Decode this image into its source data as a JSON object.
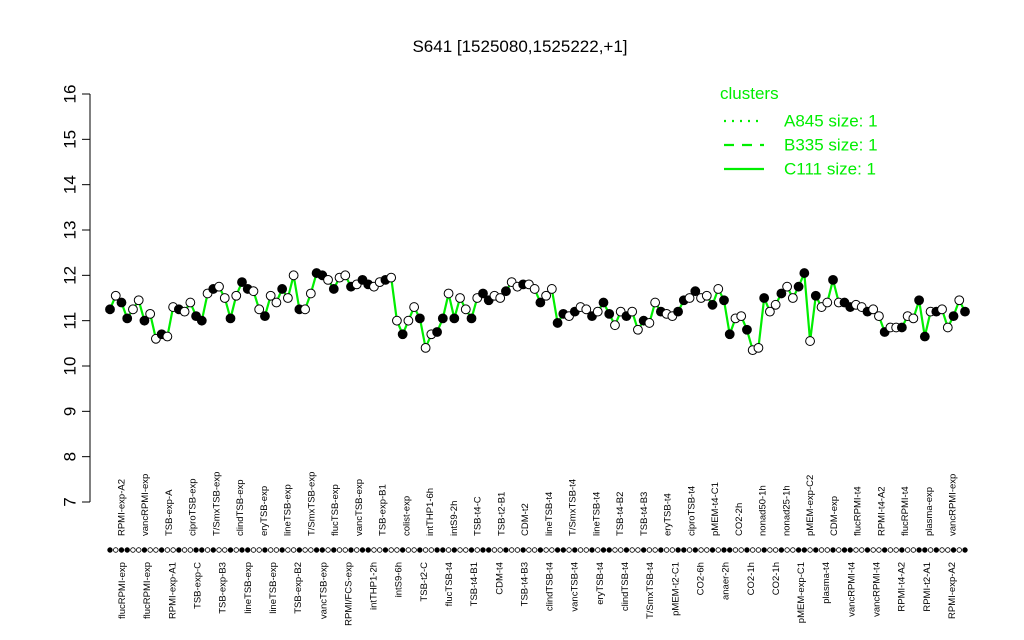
{
  "chart_data": {
    "type": "line",
    "title": "S641 [1525080,1525222,+1]",
    "xlabel": "",
    "ylabel": "",
    "ylim": [
      7,
      16
    ],
    "yticks": [
      7,
      8,
      9,
      10,
      11,
      12,
      13,
      14,
      15,
      16
    ],
    "grid": false,
    "line_color": "#00ee00",
    "legend": {
      "title": "clusters",
      "placement": "top-right",
      "color": "#00ee00",
      "entries": [
        {
          "label": "A845 size: 1",
          "style": "dotted"
        },
        {
          "label": "B335 size: 1",
          "style": "dashed"
        },
        {
          "label": "C111 size: 1",
          "style": "solid"
        }
      ]
    },
    "top_labels": [
      "RPMI-exp-A2",
      "vancRPMI-exp",
      "TSB-exp-A",
      "ciproTSB-exp",
      "T/SmxTSB-exp",
      "clindTSB-exp",
      "eryTSB-exp",
      "lineTSB-exp",
      "T/SmxTSB-exp",
      "flucTSB-exp",
      "vancTSB-exp",
      "TSB-exp-B1",
      "colist-exp",
      "intTHP1-6h",
      "intS9-2h",
      "TSB-t4-C",
      "TSB-t2-B1",
      "CDM-t2",
      "lineTSB-t4",
      "T/SmxTSB-t4",
      "lineTSB-t4",
      "TSB-t4-B2",
      "TSB-t4-B3",
      "eryTSB-t4",
      "ciproTSB-t4",
      "pMEM-t4-C1",
      "CO2-2h",
      "nonad50-1h",
      "nonad25-1h",
      "pMEM-exp-C2",
      "CDM-exp",
      "flucRPMI-t4",
      "RPMI-t4-A2",
      "flucRPMI-t4",
      "plasma-exp",
      "vancRPMI-exp"
    ],
    "bottom_labels": [
      "flucRPMI-exp",
      "flucRPMI-exp",
      "RPMI-exp-A1",
      "TSB-exp-C",
      "TSB-exp-B3",
      "lineTSB-exp",
      "lineTSB-exp",
      "TSB-exp-B2",
      "vancTSB-exp",
      "RPMI/FCS-exp",
      "intTHP1-2h",
      "intS9-6h",
      "TSB-t2-C",
      "flucTSB-t4",
      "TSB-t4-B1",
      "CDM-t4",
      "TSB-t4-B3",
      "clindTSB-t4",
      "vancTSB-t4",
      "eryTSB-t4",
      "clindTSB-t4",
      "T/SmxTSB-t4",
      "pMEM-t2-C1",
      "CO2-6h",
      "anaer-2h",
      "CO2-1h",
      "CO2-1h",
      "pMEM-exp-C1",
      "plasma-t4",
      "vancRPMI-t4",
      "vancRPMI-t4",
      "RPMI-t4-A2",
      "RPMI-t2-A1",
      "RPMI-exp-A2"
    ],
    "series": [
      {
        "values": [
          11.25,
          11.55,
          11.4,
          11.05,
          11.25,
          11.45,
          11.0,
          11.15,
          10.6,
          10.7,
          10.65,
          11.3,
          11.25,
          11.2,
          11.4,
          11.1,
          11.0,
          11.6,
          11.7,
          11.75,
          11.5,
          11.05,
          11.55,
          11.85,
          11.7,
          11.65,
          11.25,
          11.1,
          11.55,
          11.4,
          11.7,
          11.5,
          12.0,
          11.25,
          11.25,
          11.6,
          12.05,
          12.0,
          11.9,
          11.7,
          11.95,
          12.0,
          11.75,
          11.8,
          11.9,
          11.8,
          11.75,
          11.85,
          11.9,
          11.95,
          11.0,
          10.7,
          11.0,
          11.3,
          11.05,
          10.4,
          10.7,
          10.75,
          11.05,
          11.6,
          11.05,
          11.5,
          11.25,
          11.05,
          11.5,
          11.6,
          11.45,
          11.55,
          11.5,
          11.65,
          11.85,
          11.75,
          11.8,
          11.8,
          11.7,
          11.4,
          11.55,
          11.7,
          10.95,
          11.15,
          11.1,
          11.2,
          11.3,
          11.25,
          11.1,
          11.2,
          11.4,
          11.15,
          10.9,
          11.2,
          11.1,
          11.2,
          10.8,
          11.0,
          10.95,
          11.4,
          11.2,
          11.15,
          11.1,
          11.2,
          11.45,
          11.5,
          11.65,
          11.5,
          11.55,
          11.35,
          11.7,
          11.45,
          10.7,
          11.05,
          11.1,
          10.8,
          10.35,
          10.4,
          11.5,
          11.2,
          11.35,
          11.6,
          11.75,
          11.5,
          11.75,
          12.05,
          10.55,
          11.55,
          11.3,
          11.4,
          11.9,
          11.4,
          11.4,
          11.3,
          11.35,
          11.3,
          11.2,
          11.25,
          11.1,
          10.75,
          10.85,
          10.85,
          10.85,
          11.1,
          11.05,
          11.45,
          10.65,
          11.2,
          11.2,
          11.25,
          10.85,
          11.1,
          11.45,
          11.2
        ]
      }
    ]
  }
}
